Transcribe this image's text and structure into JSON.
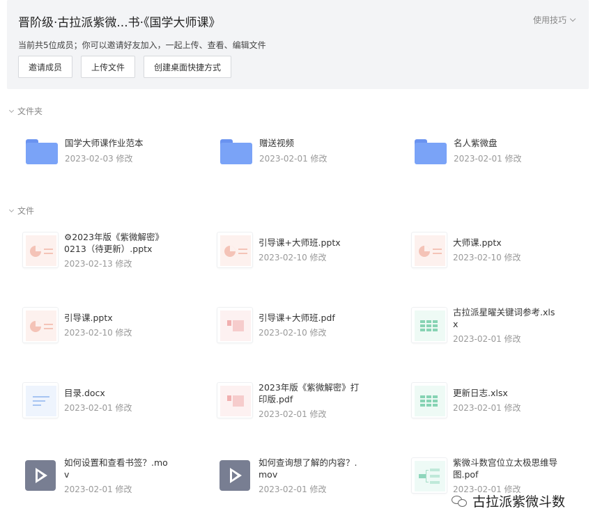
{
  "header": {
    "title": "晋阶级·古拉派紫微...书·《国学大师课》",
    "tips_label": "使用技巧",
    "subtitle": "当前共5位成员；你可以邀请好友加入，一起上传、查看、编辑文件",
    "buttons": [
      "邀请成员",
      "上传文件",
      "创建桌面快捷方式"
    ]
  },
  "sections": {
    "folders_label": "文件夹",
    "files_label": "文件"
  },
  "folders": [
    {
      "name": "国学大师课作业范本",
      "meta": "2023-02-03  修改"
    },
    {
      "name": "赠送视频",
      "meta": "2023-02-01  修改"
    },
    {
      "name": "名人紫微盘",
      "meta": "2023-02-01  修改"
    }
  ],
  "files": [
    {
      "name": "⚙2023年版《紫微解密》0213（待更新）.pptx",
      "meta": "2023-02-13  修改",
      "type": "pptx"
    },
    {
      "name": "引导课+大师班.pptx",
      "meta": "2023-02-10  修改",
      "type": "pptx"
    },
    {
      "name": "大师课.pptx",
      "meta": "2023-02-10  修改",
      "type": "pptx"
    },
    {
      "name": "引导课.pptx",
      "meta": "2023-02-10  修改",
      "type": "pptx"
    },
    {
      "name": "引导课+大师班.pdf",
      "meta": "2023-02-10  修改",
      "type": "pdf"
    },
    {
      "name": "古拉派星曜关键词参考.xlsx",
      "meta": "2023-02-01  修改",
      "type": "xlsx"
    },
    {
      "name": "目录.docx",
      "meta": "2023-02-01  修改",
      "type": "docx"
    },
    {
      "name": "2023年版《紫微解密》打印版.pdf",
      "meta": "2023-02-01  修改",
      "type": "pdf"
    },
    {
      "name": "更新日志.xlsx",
      "meta": "2023-02-01  修改",
      "type": "xlsx"
    },
    {
      "name": "如何设置和查看书签？.mov",
      "meta": "2023-02-01  修改",
      "type": "mov"
    },
    {
      "name": "如何查询想了解的内容？.mov",
      "meta": "2023-02-01  修改",
      "type": "mov"
    },
    {
      "name": "紫微斗数宫位立太极思维导图.pof",
      "meta": "2023-02-01  修改",
      "type": "mindmap"
    }
  ],
  "watermark": {
    "text": "古拉派紫微斗数"
  }
}
